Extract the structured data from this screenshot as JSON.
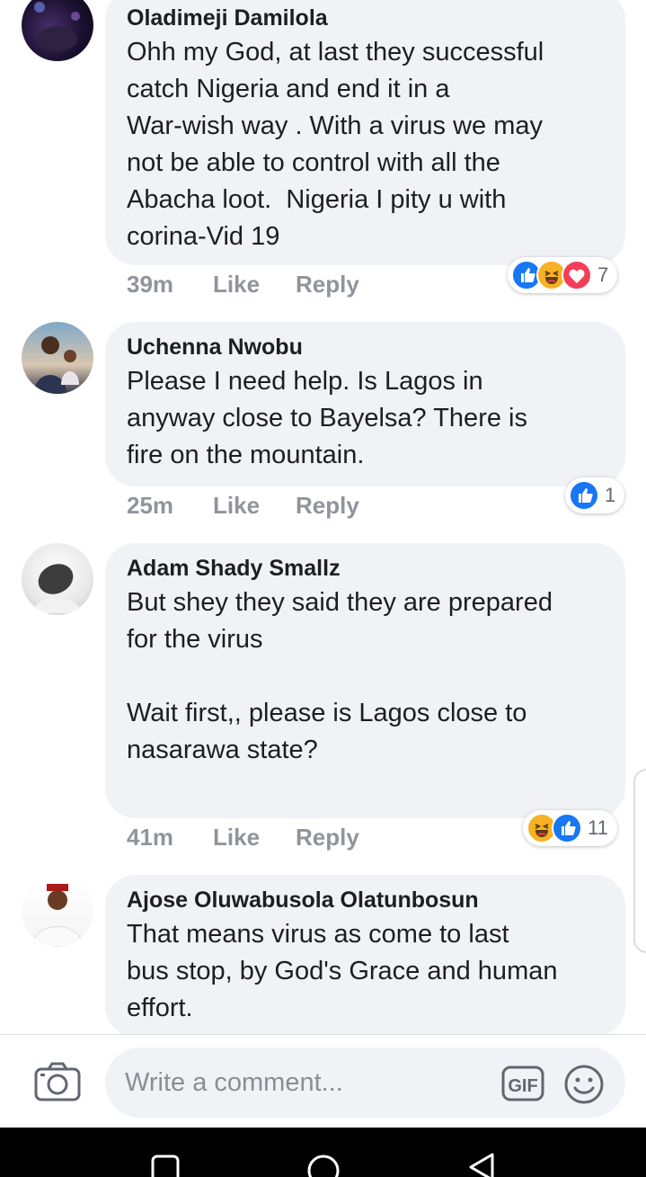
{
  "comments": [
    {
      "author": "Oladimeji Damilola",
      "text": "Ohh my God, at last they successful\ncatch Nigeria and end it in a\nWar-wish way . With a virus we may\nnot be able to control with all the\nAbacha loot.  Nigeria I pity u with\ncorina-Vid 19",
      "time": "39m",
      "like_label": "Like",
      "reply_label": "Reply",
      "reactions": [
        "like-icon",
        "haha-icon",
        "love-icon"
      ],
      "reaction_count": "7"
    },
    {
      "author": "Uchenna Nwobu",
      "text": "Please I need help. Is Lagos in\nanyway close to Bayelsa? There is\nfire on the mountain.",
      "time": "25m",
      "like_label": "Like",
      "reply_label": "Reply",
      "reactions": [
        "like-icon"
      ],
      "reaction_count": "1"
    },
    {
      "author": "Adam Shady Smallz",
      "text": "But shey they said they are prepared\nfor the virus\n\nWait first,, please is Lagos close to\nnasarawa state?",
      "time": "41m",
      "like_label": "Like",
      "reply_label": "Reply",
      "reactions": [
        "haha-icon",
        "like-icon"
      ],
      "reaction_count": "11"
    },
    {
      "author": "Ajose Oluwabusola Olatunbosun",
      "text": "That means virus as come to last\nbus stop, by God's Grace and human\neffort."
    }
  ],
  "composer": {
    "placeholder": "Write a comment...",
    "gif_label": "GIF"
  },
  "colors": {
    "like_blue": "#1877f2",
    "love_red": "#f33e58",
    "haha_yellow": "#f7b125",
    "bubble_bg": "#f0f2f5",
    "meta_gray": "#90949c"
  }
}
